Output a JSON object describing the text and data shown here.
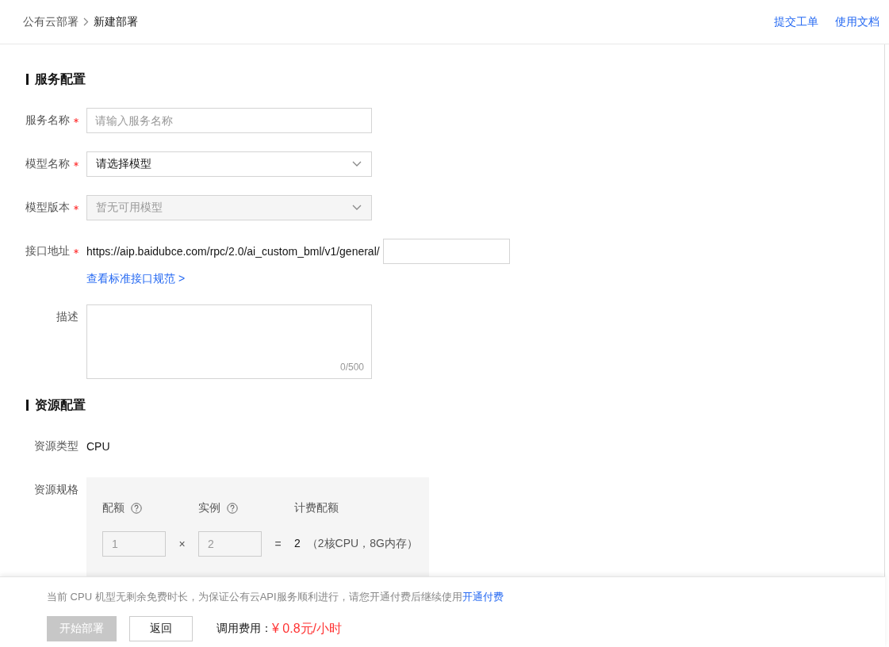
{
  "breadcrumb": [
    {
      "label": "公有云部署",
      "current": false
    },
    {
      "label": "新建部署",
      "current": true
    }
  ],
  "header_links": [
    "提交工单",
    "使用文档"
  ],
  "sections": [
    {
      "title": "服务配置",
      "fields": [
        {
          "kind": "text",
          "label": "服务名称",
          "required": true,
          "placeholder": "请输入服务名称"
        },
        {
          "kind": "select",
          "label": "模型名称",
          "required": true,
          "value": "请选择模型",
          "disabled": false
        },
        {
          "kind": "select",
          "label": "模型版本",
          "required": true,
          "value": "暂无可用模型",
          "disabled": true
        },
        {
          "kind": "endpoint",
          "label": "接口地址",
          "required": true,
          "prefix": "https://aip.baidubce.com/rpc/2.0/ai_custom_bml/v1/general/",
          "link": "查看标准接口规范 >"
        },
        {
          "kind": "textarea",
          "label": "描述",
          "required": false,
          "counter": "0/500"
        }
      ]
    },
    {
      "title": "资源配置",
      "fields": [
        {
          "kind": "static",
          "label": "资源类型",
          "required": false,
          "value": "CPU"
        },
        {
          "kind": "spec",
          "label": "资源规格",
          "required": false,
          "columns": [
            {
              "label": "配额",
              "help": true
            },
            {
              "label": "实例",
              "help": true
            },
            {
              "label": "计费配额",
              "help": false
            }
          ],
          "inputs": [
            {
              "value": "1",
              "disabled": true
            },
            {
              "value": "2",
              "disabled": true
            }
          ],
          "operators": [
            "×",
            "="
          ],
          "result": "2",
          "result_note": "（2核CPU，8G内存）"
        }
      ]
    }
  ],
  "footer": {
    "notice": "当前 CPU 机型无剩余免费时长，为保证公有云API服务顺利进行，请您开通付费后继续使用",
    "notice_link": "开通付费",
    "buttons": [
      {
        "label": "开始部署",
        "kind": "primary",
        "disabled": true
      },
      {
        "label": "返回",
        "kind": "default",
        "disabled": false
      }
    ],
    "cost_label": "调用费用：",
    "cost_value": "¥ 0.8元/小时"
  }
}
